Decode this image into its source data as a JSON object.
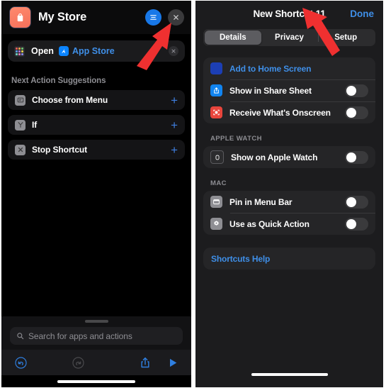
{
  "left_screen": {
    "header": {
      "app_icon": "shopping-bag-icon",
      "title": "My Store",
      "settings_button": "sliders-icon",
      "close_button": "close-icon"
    },
    "action": {
      "icon": "apps-grid-icon",
      "verb": "Open",
      "target_icon": "app-store-icon",
      "target": "App Store",
      "remove_button": "remove-icon"
    },
    "suggestions": {
      "title": "Next Action Suggestions",
      "items": [
        {
          "icon": "menu-list-icon",
          "label": "Choose from Menu",
          "add": "+"
        },
        {
          "icon": "if-branch-icon",
          "label": "If",
          "add": "+"
        },
        {
          "icon": "stop-x-icon",
          "label": "Stop Shortcut",
          "add": "+"
        }
      ]
    },
    "search": {
      "icon": "search-icon",
      "placeholder": "Search for apps and actions"
    },
    "toolbar": [
      {
        "name": "undo-icon",
        "state": "enabled"
      },
      {
        "name": "redo-icon",
        "state": "disabled"
      },
      {
        "name": "share-icon",
        "state": "enabled"
      },
      {
        "name": "play-icon",
        "state": "enabled"
      }
    ]
  },
  "right_screen": {
    "header": {
      "title": "New Shortcut 11",
      "done_label": "Done"
    },
    "segments": [
      {
        "label": "Details",
        "selected": true
      },
      {
        "label": "Privacy",
        "selected": false
      },
      {
        "label": "Setup",
        "selected": false
      }
    ],
    "main_group": [
      {
        "icon": "home-screen-grid-icon",
        "label": "Add to Home Screen",
        "type": "link"
      },
      {
        "icon": "share-sheet-icon",
        "label": "Show in Share Sheet",
        "type": "toggle",
        "value": "off"
      },
      {
        "icon": "onscreen-scan-icon",
        "label": "Receive What's Onscreen",
        "type": "toggle",
        "value": "off"
      }
    ],
    "apple_watch": {
      "section_title": "APPLE WATCH",
      "rows": [
        {
          "icon": "apple-watch-icon",
          "label": "Show on Apple Watch",
          "type": "toggle",
          "value": "off"
        }
      ]
    },
    "mac": {
      "section_title": "MAC",
      "rows": [
        {
          "icon": "menu-bar-icon",
          "label": "Pin in Menu Bar",
          "type": "toggle",
          "value": "off"
        },
        {
          "icon": "gear-icon",
          "label": "Use as Quick Action",
          "type": "toggle",
          "value": "off"
        }
      ]
    },
    "help": {
      "label": "Shortcuts Help"
    }
  },
  "annotations": {
    "arrow_left": "red-arrow-pointing-to-settings-button",
    "arrow_right": "red-arrow-pointing-to-add-to-home-screen"
  },
  "colors": {
    "accent_blue": "#3f8fe8",
    "button_blue": "#1878e8",
    "annotation_red": "#ef3030",
    "app_icon": "#f4705a"
  }
}
